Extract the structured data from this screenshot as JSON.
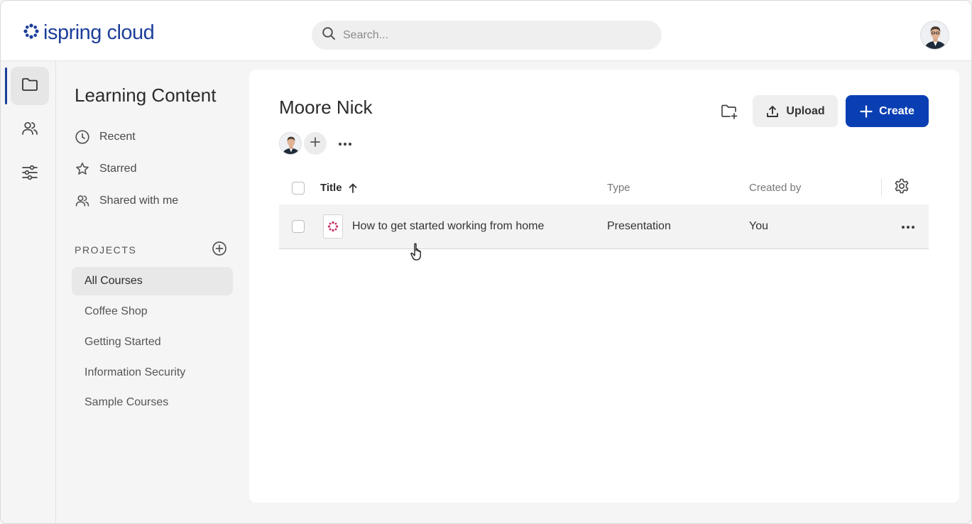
{
  "header": {
    "logo_text": "ispring cloud",
    "search_placeholder": "Search..."
  },
  "rail": {
    "items": [
      {
        "icon": "folder-icon",
        "active": true
      },
      {
        "icon": "users-icon",
        "active": false
      },
      {
        "icon": "sliders-icon",
        "active": false
      }
    ]
  },
  "sidebar": {
    "title": "Learning Content",
    "nav": [
      {
        "label": "Recent",
        "icon": "clock-icon"
      },
      {
        "label": "Starred",
        "icon": "star-icon"
      },
      {
        "label": "Shared with me",
        "icon": "users-icon"
      }
    ],
    "projects_label": "PROJECTS",
    "projects": [
      {
        "label": "All Courses",
        "active": true
      },
      {
        "label": "Coffee Shop",
        "active": false
      },
      {
        "label": "Getting Started",
        "active": false
      },
      {
        "label": "Information Security",
        "active": false
      },
      {
        "label": "Sample Courses",
        "active": false
      }
    ]
  },
  "main": {
    "title": "Moore Nick",
    "upload_label": "Upload",
    "create_label": "Create",
    "columns": {
      "title": "Title",
      "type": "Type",
      "created_by": "Created by"
    },
    "rows": [
      {
        "title": "How to get started working from home",
        "type": "Presentation",
        "created_by": "You"
      }
    ]
  },
  "colors": {
    "brand": "#1d3f9a",
    "primary_button": "#0a3fb4",
    "file_icon_accent": "#c8336a"
  }
}
